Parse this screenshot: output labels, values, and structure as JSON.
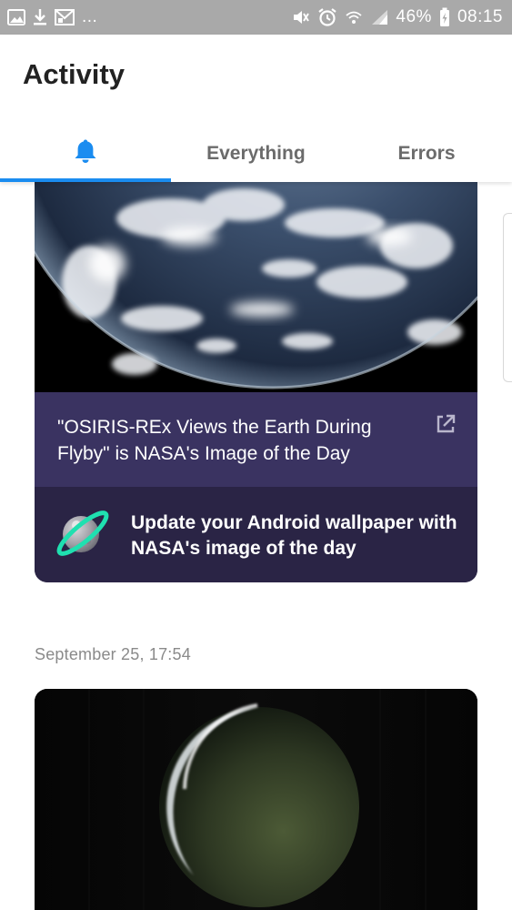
{
  "status_bar": {
    "notification_icons": [
      "image-icon",
      "download-icon",
      "mail-icon"
    ],
    "more_indicator": "...",
    "battery_percent": "46%",
    "time": "08:15"
  },
  "header": {
    "title": "Activity",
    "tabs": [
      {
        "label": "",
        "icon": "bell-icon",
        "active": true
      },
      {
        "label": "Everything",
        "active": false
      },
      {
        "label": "Errors",
        "active": false
      }
    ]
  },
  "feed": {
    "items": [
      {
        "image": "earth-from-space",
        "story_title": "\"OSIRIS-REx Views the Earth During Flyby\" is NASA's Image of the Day",
        "promo_text": "Update your Android wallpaper with NASA's image of the day"
      },
      {
        "timestamp": "September 25, 17:54",
        "image": "crescent-moon"
      }
    ]
  },
  "colors": {
    "accent": "#1a8cf0",
    "card_story_bg": "#3a3361",
    "card_promo_bg": "#2a2445",
    "planet_ring": "#1fe0b0",
    "status_bar_bg": "#a9a9a9"
  }
}
